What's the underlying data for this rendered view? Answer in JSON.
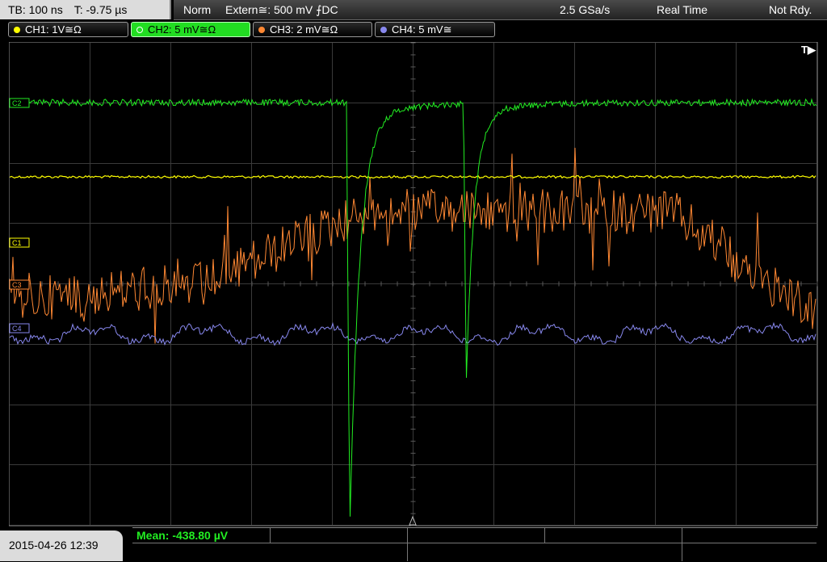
{
  "header": {
    "timebase": "TB: 100 ns",
    "trigger_time": "T: -9.75 µs",
    "mode": "Norm",
    "trigger_source": "Extern≅: 500 mV ⨍DC",
    "sample_rate": "2.5 GSa/s",
    "acq_mode": "Real Time",
    "status": "Not Rdy."
  },
  "channels": [
    {
      "label": "CH1: 1V≅Ω",
      "color": "#ffff00",
      "active": false
    },
    {
      "label": "CH2: 5 mV≅Ω",
      "color": "#22dd22",
      "active": true
    },
    {
      "label": "CH3: 2 mV≅Ω",
      "color": "#ff8833",
      "active": false
    },
    {
      "label": "CH4: 5 mV≅",
      "color": "#8888ee",
      "active": false
    }
  ],
  "markers": {
    "c1": "C1",
    "c2": "C2",
    "c3": "C3",
    "c4": "C4"
  },
  "trigger_marker": "T▶",
  "footer": {
    "datetime": "2015-04-26 12:39",
    "measurement": "Mean: -438.80 µV"
  }
}
